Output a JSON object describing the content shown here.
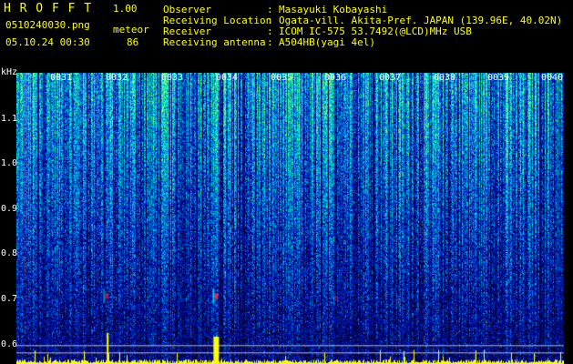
{
  "app": {
    "title": "H R O F F T",
    "version": "1.00"
  },
  "file": {
    "name": "0510240030.png",
    "timestamp": "05.10.24 00:30"
  },
  "counter": {
    "label": "meteor",
    "value": "86"
  },
  "info": {
    "labels": [
      "Observer",
      "Receiving Location",
      "Receiver",
      "Receiving antenna"
    ],
    "colons": [
      ":",
      ":",
      ":",
      ":"
    ],
    "values": [
      "Masayuki Kobayashi",
      "Ogata-vill. Akita-Pref. JAPAN (139.96E, 40.02N)",
      "ICOM IC-575 53.7492(@LCD)MHz USB",
      "A504HB(yagi 4el)"
    ]
  },
  "axis": {
    "y_unit": "kHz",
    "y_ticks": [
      "1.1",
      "1.0",
      "0.9",
      "0.8",
      "0.7",
      "0.6"
    ],
    "x_ticks": [
      "0031",
      "0032",
      "0033",
      "0034",
      "0035",
      "0036",
      "0037",
      "0038",
      "0039",
      "0040"
    ]
  },
  "colors": {
    "yellow": "#ffff00",
    "cyan": "#00ffff",
    "white": "#ffffff"
  },
  "spectrogram": {
    "y_range_khz": [
      0.58,
      1.18
    ],
    "meteor_echoes": [
      {
        "minute": 3.15,
        "khz": 0.72,
        "strength": 0.9
      },
      {
        "minute": 1.15,
        "khz": 0.72,
        "strength": 0.6
      },
      {
        "minute": 5.35,
        "khz": 0.715,
        "strength": 0.35
      },
      {
        "minute": 6.5,
        "khz": 0.71,
        "strength": 0.2
      }
    ]
  }
}
